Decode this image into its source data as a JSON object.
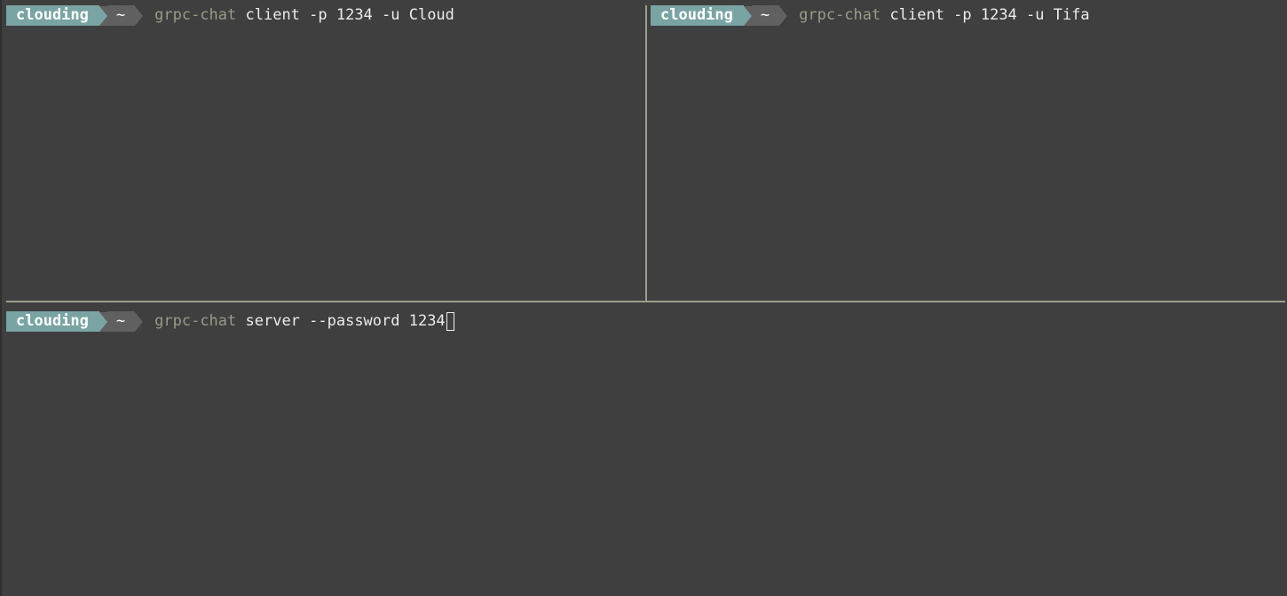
{
  "panes": [
    {
      "id": "top-left",
      "prompt": {
        "user": "clouding",
        "dir": "~"
      },
      "command": {
        "name": "grpc-chat",
        "args": " client -p 1234 -u Cloud"
      },
      "cursor": false
    },
    {
      "id": "top-right",
      "prompt": {
        "user": "clouding",
        "dir": "~"
      },
      "command": {
        "name": "grpc-chat",
        "args": " client -p 1234 -u Tifa"
      },
      "cursor": false
    },
    {
      "id": "bottom",
      "prompt": {
        "user": "clouding",
        "dir": "~"
      },
      "command": {
        "name": "grpc-chat",
        "args": " server --password 1234"
      },
      "cursor": true
    }
  ],
  "colors": {
    "background": "#3f3f3f",
    "prompt_user_bg": "#7aa3a3",
    "prompt_dir_bg": "#606060",
    "command_name": "#9a9a88",
    "pane_divider": "#9e9e8c"
  }
}
